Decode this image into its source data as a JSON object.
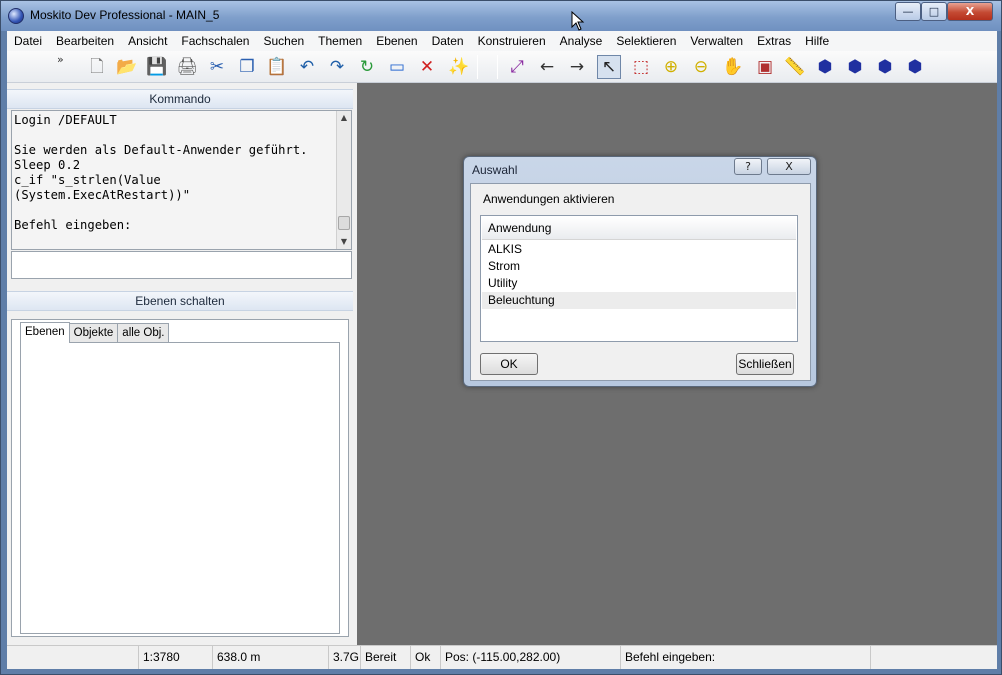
{
  "window": {
    "title": "Moskito Dev Professional - MAIN_5",
    "controls": {
      "minimize": "—",
      "maximize": "□",
      "close": "X"
    }
  },
  "menubar": {
    "items": [
      "Datei",
      "Bearbeiten",
      "Ansicht",
      "Fachschalen",
      "Suchen",
      "Themen",
      "Ebenen",
      "Daten",
      "Konstruieren",
      "Analyse",
      "Selektieren",
      "Verwalten",
      "Extras",
      "Hilfe"
    ]
  },
  "toolbar": {
    "grip": "»",
    "icons": [
      {
        "name": "new-document-icon",
        "glyph": "🗋"
      },
      {
        "name": "open-folder-icon",
        "glyph": "📂"
      },
      {
        "name": "save-icon",
        "glyph": "💾"
      },
      {
        "name": "print-icon",
        "glyph": "🖨"
      },
      {
        "name": "cut-icon",
        "glyph": "✂"
      },
      {
        "name": "copy-icon",
        "glyph": "❐"
      },
      {
        "name": "paste-icon",
        "glyph": "📋"
      },
      {
        "name": "undo-icon",
        "glyph": "↶"
      },
      {
        "name": "redo-icon",
        "glyph": "↷"
      },
      {
        "name": "refresh-icon",
        "glyph": "↻"
      },
      {
        "name": "window-icon",
        "glyph": "▭"
      },
      {
        "name": "delete-icon",
        "glyph": "✕"
      },
      {
        "name": "magic-icon",
        "glyph": "✨"
      },
      {
        "name": "zoom-extent-icon",
        "glyph": "⤢"
      },
      {
        "name": "zoom-back-icon",
        "glyph": "←"
      },
      {
        "name": "zoom-forward-icon",
        "glyph": "→"
      },
      {
        "name": "select-pointer-icon",
        "glyph": "↖"
      },
      {
        "name": "select-area-icon",
        "glyph": "⬚"
      },
      {
        "name": "zoom-in-icon",
        "glyph": "⊕"
      },
      {
        "name": "zoom-out-icon",
        "glyph": "⊖"
      },
      {
        "name": "pan-hand-icon",
        "glyph": "✋"
      },
      {
        "name": "map-image-icon",
        "glyph": "▣"
      },
      {
        "name": "measure-ruler-icon",
        "glyph": "📏"
      },
      {
        "name": "network-icon-1",
        "glyph": "⬢"
      },
      {
        "name": "network-icon-2",
        "glyph": "⬢"
      },
      {
        "name": "network-icon-3",
        "glyph": "⬢"
      },
      {
        "name": "network-icon-4",
        "glyph": "⬢"
      }
    ]
  },
  "kommando": {
    "header": "Kommando",
    "output": "Login /DEFAULT\n\nSie werden als Default-Anwender geführt.\nSleep 0.2\nc_if \"s_strlen(Value\n(System.ExecAtRestart))\"\n\nBefehl eingeben:",
    "input_value": ""
  },
  "ebenen": {
    "header": "Ebenen schalten",
    "tabs": [
      "Ebenen",
      "Objekte",
      "alle Obj."
    ]
  },
  "statusbar": {
    "scale": "1:3780",
    "width": "638.0 m",
    "memory": "3.7G",
    "state": "Bereit",
    "ok": "Ok",
    "position": "Pos: (-115.00,282.00)",
    "prompt": "Befehl eingeben:"
  },
  "dialog": {
    "title": "Auswahl",
    "help_label": "?",
    "close_label": "X",
    "heading": "Anwendungen aktivieren",
    "list_header": "Anwendung",
    "applications": [
      "ALKIS",
      "Strom",
      "Utility",
      "Beleuchtung"
    ],
    "selected_index": 3,
    "ok_label": "OK",
    "close_button_label": "Schließen"
  }
}
